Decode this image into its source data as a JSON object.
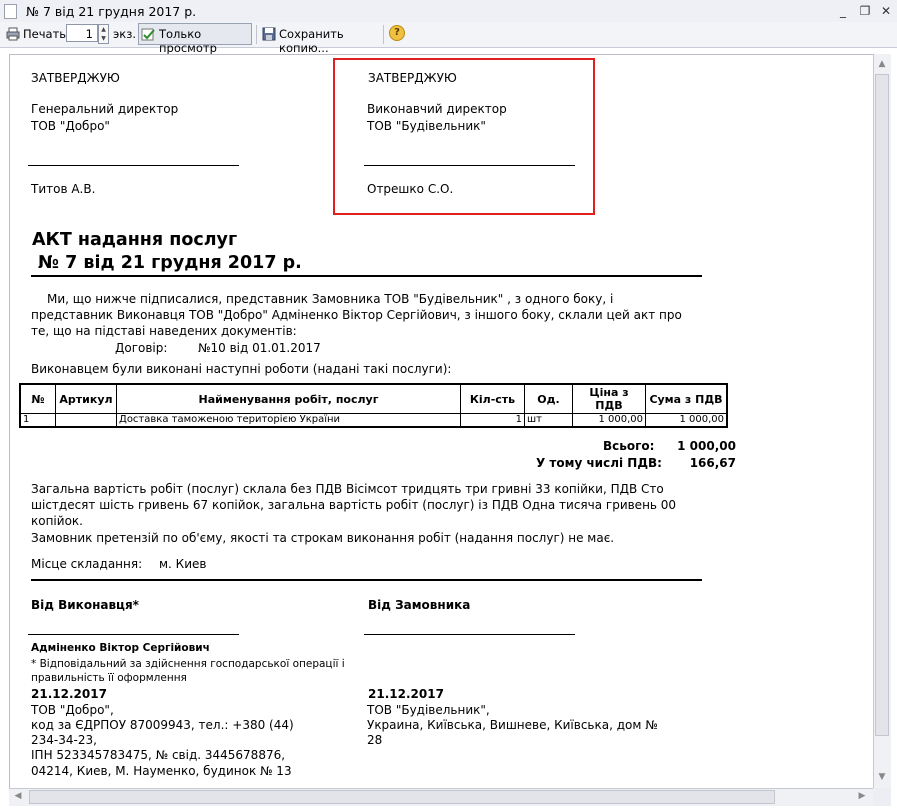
{
  "window": {
    "title": "№ 7 від 21 грудня 2017 р.",
    "minimize": "_",
    "restore": "❐",
    "close": "✕"
  },
  "toolbar": {
    "print_label": "Печать",
    "copies_value": "1",
    "copies_unit": "экз.",
    "view_only_label": "Только просмотр",
    "save_copy_label": "Сохранить копию...",
    "help_label": "?"
  },
  "document": {
    "approve_left": {
      "heading": "ЗАТВЕРДЖУЮ",
      "position": "Генеральний директор",
      "company": "ТОВ \"Добро\"",
      "signer": "Титов А.В."
    },
    "approve_right": {
      "heading": "ЗАТВЕРДЖУЮ",
      "position": "Виконавчий директор",
      "company": "ТОВ \"Будівельник\"",
      "signer": "Отрешко  С.О."
    },
    "title_line1": "АКТ надання послуг",
    "title_line2": "№ 7 від 21 грудня 2017 р.",
    "intro_line1": "Ми, що нижче підписалися, представник Замовника ТОВ \"Будівельник\" , з одного боку, і",
    "intro_line2": "представник Виконавця ТОВ \"Добро\" Адміненко Віктор Сергійович, з іншого боку, склали цей акт про",
    "intro_line3": "те, що на підставі наведених документів:",
    "contract_label": "Договір:",
    "contract_value": "№10 від 01.01.2017",
    "works_intro": "Виконавцем були виконані наступні роботи (надані такі послуги):",
    "table": {
      "headers": [
        "№",
        "Артикул",
        "Найменування робіт, послуг",
        "Кіл-сть",
        "Од.",
        "Ціна з ПДВ",
        "Сума з ПДВ"
      ],
      "rows": [
        [
          "1",
          "",
          "Доставка таможеною територією України",
          "1",
          "шт",
          "1 000,00",
          "1 000,00"
        ]
      ]
    },
    "total_label": "Всього:",
    "total_value": "1 000,00",
    "vat_label": "У тому числі ПДВ:",
    "vat_value": "166,67",
    "sum_line1": "Загальна вартість робіт (послуг) склала без ПДВ Вісімсот тридцять три гривні 33 копійки, ПДВ Сто",
    "sum_line2": "шістдесят шість гривень 67 копійок, загальна вартість робіт (послуг) із ПДВ Одна тисяча гривень 00",
    "sum_line3": "копійок.",
    "claims": "Замовник претензій по об'єму, якості та строкам виконання робіт (надання послуг) не має.",
    "place_label": "Місце складання:",
    "place_value": "м. Киев",
    "executor": {
      "heading": "Від Виконавця*",
      "name": "Адміненко Віктор Сергійович",
      "note1": "* Відповідальний за здійснення господарської операції і",
      "note2": "правильність її оформлення",
      "date": "21.12.2017",
      "addr1": "ТОВ \"Добро\",",
      "addr2": "код за ЄДРПОУ 87009943, тел.: +380 (44)",
      "addr3": "234-34-23,",
      "addr4": "ІПН 523345783475, № свід. 3445678876,",
      "addr5": "04214, Киев, М. Науменко, будинок № 13"
    },
    "customer": {
      "heading": "Від Замовника",
      "date": "21.12.2017",
      "addr1": "ТОВ \"Будівельник\",",
      "addr2": "Украина, Київська, Вишневе, Київська, дом №",
      "addr3": "28"
    }
  }
}
